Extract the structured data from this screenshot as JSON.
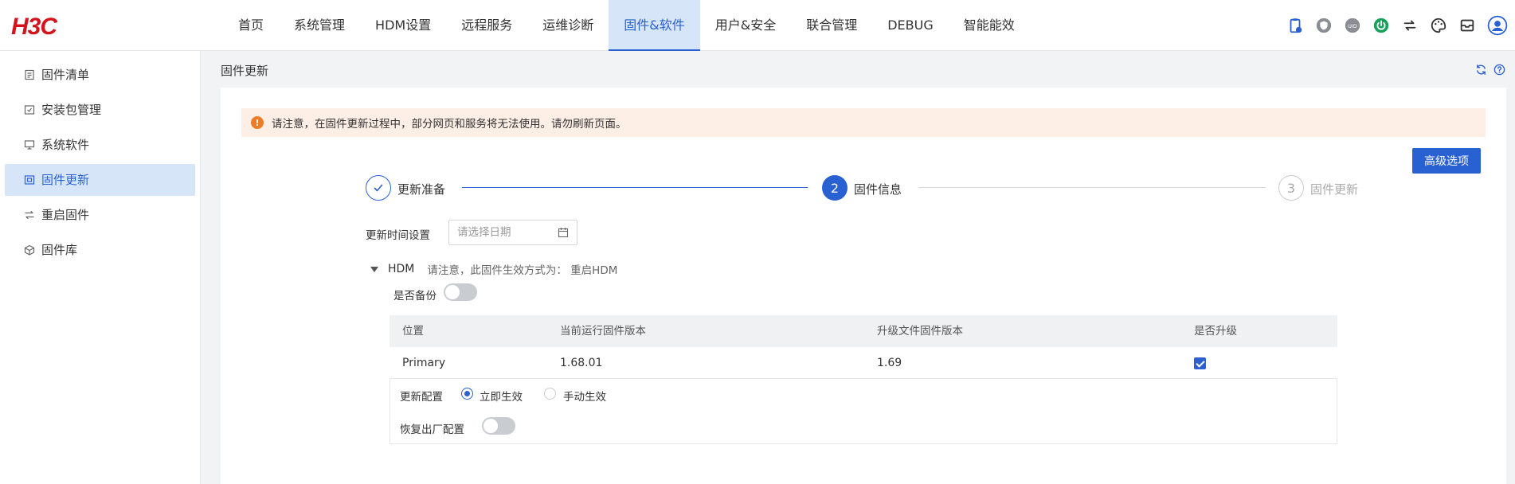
{
  "brand": {
    "logo_text": "H3C",
    "logo_color": "#d3141c"
  },
  "colors": {
    "accent": "#2a61d2",
    "active_bg": "#d7e5f9",
    "warning": "#f07b24",
    "alert_bg": "#fdeee6"
  },
  "nav": {
    "items": [
      {
        "label": "首页"
      },
      {
        "label": "系统管理"
      },
      {
        "label": "HDM设置"
      },
      {
        "label": "远程服务"
      },
      {
        "label": "运维诊断"
      },
      {
        "label": "固件&软件",
        "active": true
      },
      {
        "label": "用户&安全"
      },
      {
        "label": "联合管理"
      },
      {
        "label": "DEBUG"
      },
      {
        "label": "智能能效"
      }
    ],
    "icons": [
      "clipboard-icon",
      "shield-icon",
      "uid-icon",
      "power-icon",
      "refresh-arrows-icon",
      "palette-icon",
      "mail-icon",
      "user-avatar-icon"
    ],
    "uid_text": "UID"
  },
  "sidebar": {
    "items": [
      {
        "label": "固件清单",
        "icon": "list-icon"
      },
      {
        "label": "安装包管理",
        "icon": "package-icon"
      },
      {
        "label": "系统软件",
        "icon": "monitor-icon"
      },
      {
        "label": "固件更新",
        "icon": "chip-icon",
        "active": true
      },
      {
        "label": "重启固件",
        "icon": "swap-icon"
      },
      {
        "label": "固件库",
        "icon": "box-icon"
      }
    ]
  },
  "page": {
    "title": "固件更新",
    "alert": {
      "icon_text": "!",
      "text": "请注意，在固件更新过程中，部分网页和服务将无法使用。请勿刷新页面。"
    },
    "advanced_button": "高级选项",
    "steps": [
      {
        "number": "",
        "label": "更新准备",
        "state": "done"
      },
      {
        "number": "2",
        "label": "固件信息",
        "state": "active"
      },
      {
        "number": "3",
        "label": "固件更新",
        "state": "pending"
      }
    ],
    "schedule": {
      "label": "更新时间设置",
      "placeholder": "请选择日期"
    },
    "hdm": {
      "title": "HDM",
      "note": "请注意，此固件生效方式为：  重启HDM",
      "backup_label": "是否备份",
      "backup_on": false
    },
    "table": {
      "headers": [
        "位置",
        "当前运行固件版本",
        "升级文件固件版本",
        "是否升级"
      ],
      "rows": [
        {
          "location": "Primary",
          "current": "1.68.01",
          "upgrade": "1.69",
          "checked": true
        }
      ]
    },
    "config": {
      "label": "更新配置",
      "options": [
        {
          "label": "立即生效",
          "selected": true
        },
        {
          "label": "手动生效",
          "selected": false
        }
      ],
      "factory_label": "恢复出厂配置",
      "factory_on": false
    }
  }
}
